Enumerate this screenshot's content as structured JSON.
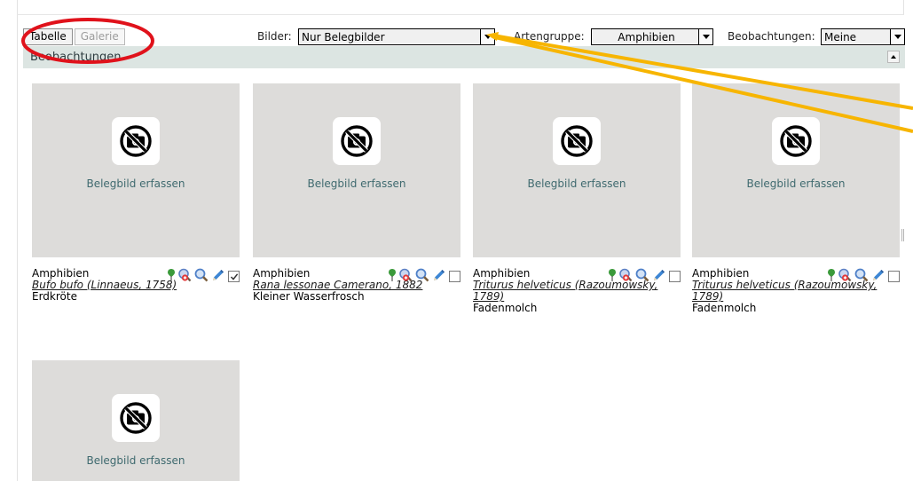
{
  "toolbar": {
    "view_table_label": "Tabelle",
    "view_gallery_label": "Galerie",
    "images_label": "Bilder:",
    "images_value": "Nur Belegbilder",
    "species_group_label": "Artengruppe:",
    "species_group_value": "Amphibien",
    "observations_label": "Beobachtungen:",
    "observations_value": "Meine"
  },
  "section": {
    "title": "Beobachtungen"
  },
  "cards": [
    {
      "capture_label": "Belegbild erfassen",
      "group": "Amphibien",
      "scientific_name": "Bufo bufo (Linnaeus, 1758)",
      "common_name": "Erdkröte",
      "checked": true
    },
    {
      "capture_label": "Belegbild erfassen",
      "group": "Amphibien",
      "scientific_name": "Rana lessonae Camerano, 1882",
      "common_name": "Kleiner Wasserfrosch",
      "checked": false
    },
    {
      "capture_label": "Belegbild erfassen",
      "group": "Amphibien",
      "scientific_name": "Triturus helveticus (Razoumowsky, 1789)",
      "common_name": "Fadenmolch",
      "checked": false
    },
    {
      "capture_label": "Belegbild erfassen",
      "group": "Amphibien",
      "scientific_name": "Triturus helveticus (Razoumowsky, 1789)",
      "common_name": "Fadenmolch",
      "checked": false
    },
    {
      "capture_label": "Belegbild erfassen"
    }
  ],
  "icons": {
    "no_photo": "no-camera-icon",
    "locate": "map-pin-icon",
    "delete": "zoom-remove-icon",
    "zoom": "magnifier-icon",
    "edit": "pencil-icon",
    "select": "checkbox"
  },
  "colors": {
    "section_header_bg": "#dce5e2",
    "image_placeholder_bg": "#dddcda",
    "capture_link": "#3f6a6f",
    "annotation_circle": "#e0121b",
    "annotation_arrow": "#f7b500"
  }
}
